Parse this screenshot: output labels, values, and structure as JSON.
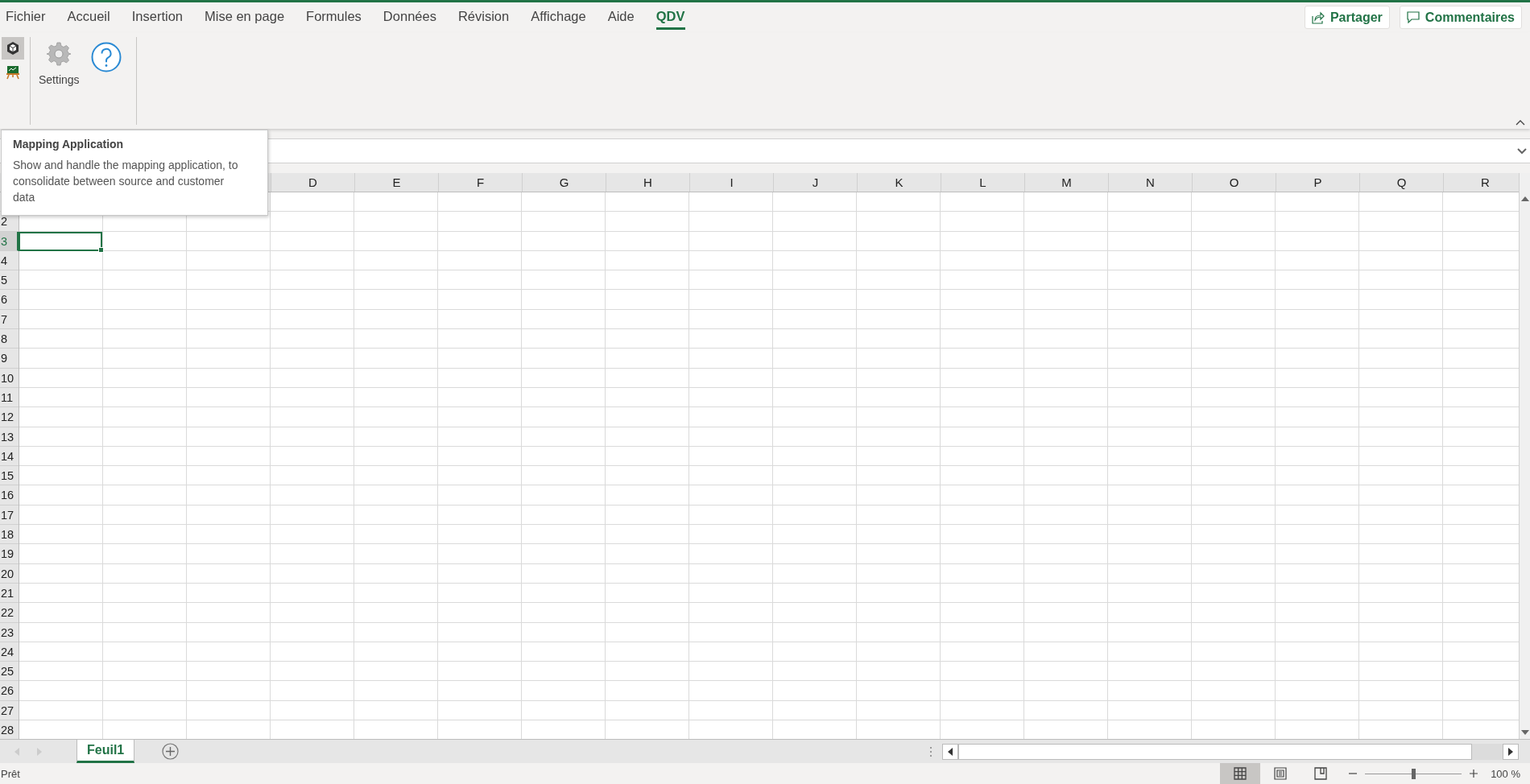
{
  "tabs": [
    {
      "label": "Fichier",
      "selected": false
    },
    {
      "label": "Accueil",
      "selected": false
    },
    {
      "label": "Insertion",
      "selected": false
    },
    {
      "label": "Mise en page",
      "selected": false
    },
    {
      "label": "Formules",
      "selected": false
    },
    {
      "label": "Données",
      "selected": false
    },
    {
      "label": "Révision",
      "selected": false
    },
    {
      "label": "Affichage",
      "selected": false
    },
    {
      "label": "Aide",
      "selected": false
    },
    {
      "label": "QDV",
      "selected": true
    }
  ],
  "share_button": {
    "label": "Partager"
  },
  "comments_button": {
    "label": "Commentaires"
  },
  "ribbon": {
    "small_buttons": [
      {
        "kind": "cube",
        "selected": true
      },
      {
        "kind": "easel",
        "selected": false
      }
    ],
    "settings_button": {
      "label": "Settings"
    }
  },
  "tooltip": {
    "title": "Mapping Application",
    "text": "Show and handle the mapping application, to consolidate between source and customer data"
  },
  "grid": {
    "columns": [
      "D",
      "E",
      "F",
      "G",
      "H",
      "I",
      "J",
      "K",
      "L",
      "M",
      "N",
      "O",
      "P",
      "Q",
      "R"
    ],
    "rows": [
      {
        "label": "2",
        "selected": false
      },
      {
        "label": "3",
        "selected": true
      },
      {
        "label": "4",
        "selected": false
      },
      {
        "label": "5",
        "selected": false
      },
      {
        "label": "6",
        "selected": false
      },
      {
        "label": "7",
        "selected": false
      },
      {
        "label": "8",
        "selected": false
      },
      {
        "label": "9",
        "selected": false
      },
      {
        "label": "10",
        "selected": false
      },
      {
        "label": "11",
        "selected": false
      },
      {
        "label": "12",
        "selected": false
      },
      {
        "label": "13",
        "selected": false
      },
      {
        "label": "14",
        "selected": false
      },
      {
        "label": "15",
        "selected": false
      },
      {
        "label": "16",
        "selected": false
      },
      {
        "label": "17",
        "selected": false
      },
      {
        "label": "18",
        "selected": false
      },
      {
        "label": "19",
        "selected": false
      },
      {
        "label": "20",
        "selected": false
      },
      {
        "label": "21",
        "selected": false
      },
      {
        "label": "22",
        "selected": false
      },
      {
        "label": "23",
        "selected": false
      },
      {
        "label": "24",
        "selected": false
      },
      {
        "label": "25",
        "selected": false
      },
      {
        "label": "26",
        "selected": false
      },
      {
        "label": "27",
        "selected": false
      },
      {
        "label": "28",
        "selected": false
      }
    ]
  },
  "sheet_tabs": [
    {
      "label": "Feuil1",
      "selected": true
    }
  ],
  "status_bar": {
    "text": "Prêt",
    "views": [
      {
        "kind": "normal",
        "selected": true
      },
      {
        "kind": "page_layout",
        "selected": false
      },
      {
        "kind": "page_break",
        "selected": false
      }
    ],
    "zoom": {
      "level": 0.5,
      "reading": "100 %"
    }
  }
}
